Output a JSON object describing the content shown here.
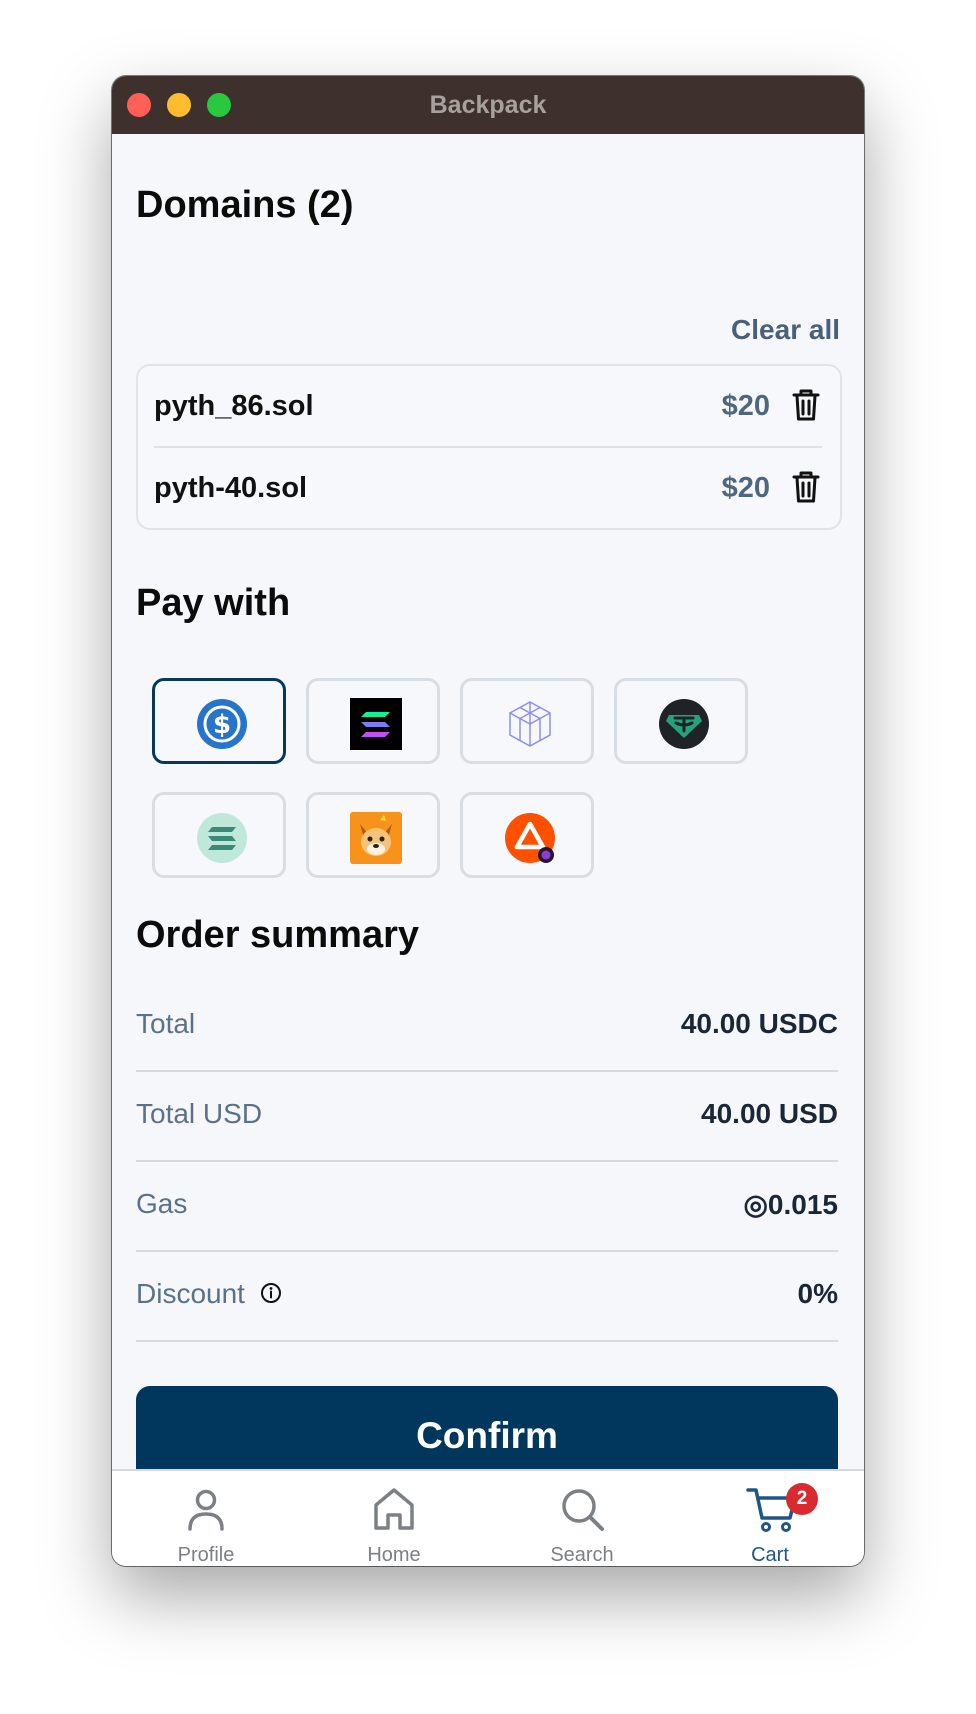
{
  "window": {
    "title": "Backpack"
  },
  "domains": {
    "heading": "Domains (2)",
    "clear_all": "Clear all",
    "items": [
      {
        "name": "pyth_86.sol",
        "price": "$20"
      },
      {
        "name": "pyth-40.sol",
        "price": "$20"
      }
    ]
  },
  "pay_with": {
    "heading": "Pay with",
    "tokens": [
      {
        "icon": "usdc-icon",
        "color": "#2775ca",
        "selected": true
      },
      {
        "icon": "solana-icon",
        "color": "#000000",
        "selected": false
      },
      {
        "icon": "cube-icon",
        "color": "#8b8ff0",
        "selected": false
      },
      {
        "icon": "tether-icon",
        "color": "#26a17b",
        "selected": false
      },
      {
        "icon": "staked-sol-icon",
        "color": "#b9e6d7",
        "selected": false
      },
      {
        "icon": "bonk-dog-icon",
        "color": "#f7931a",
        "selected": false
      },
      {
        "icon": "bat-triangle-icon",
        "color": "#ff5000",
        "selected": false
      }
    ]
  },
  "order_summary": {
    "heading": "Order summary",
    "rows": [
      {
        "label": "Total",
        "value": "40.00 USDC"
      },
      {
        "label": "Total USD",
        "value": "40.00 USD"
      },
      {
        "label": "Gas",
        "value": "◎0.015"
      },
      {
        "label": "Discount",
        "value": "0%"
      }
    ]
  },
  "confirm_label": "Confirm",
  "tabs": [
    {
      "label": "Profile",
      "icon": "person-icon"
    },
    {
      "label": "Home",
      "icon": "home-icon"
    },
    {
      "label": "Search",
      "icon": "search-icon"
    },
    {
      "label": "Cart",
      "icon": "cart-icon",
      "badge": "2",
      "active": true
    }
  ],
  "colors": {
    "primary": "#02375d",
    "muted_text": "#5a7189",
    "badge": "#d92b2f",
    "active_tab": "#1e5688"
  }
}
